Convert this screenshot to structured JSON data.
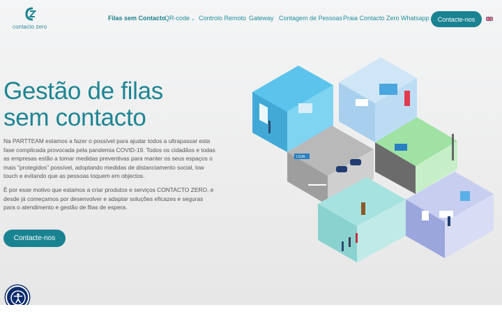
{
  "brand": {
    "logo_text": "contacto zero",
    "logo_mark": "CZ"
  },
  "nav": {
    "items": [
      {
        "label": "Filas sem Contacto",
        "active": true
      },
      {
        "label": "QR-code",
        "dropdown": true
      },
      {
        "label": "Controlo Remoto"
      },
      {
        "label": "Gateway"
      },
      {
        "label": "Contagem de Pessoas"
      },
      {
        "label": "Praia Contacto Zero"
      },
      {
        "label": "Whatsapp"
      }
    ],
    "cta_label": "Contacte-nos",
    "language_flag": "uk-flag-icon"
  },
  "hero": {
    "title_line1": "Gestão de filas",
    "title_line2": "sem contacto",
    "paragraph1": "Na PARTTEAM estamos a fazer o possível para ajudar todos a ultrapassar esta fase complicada provocada pela pandemia COVID-19. Todos os cidadãos e todas as empresas estão a tomar medidas preventivas para manter os seus espaços o mais \"protegidos\" possível, adoptando medidas de distanciamento social, low touch e evitando que as pessoas toquem em objectos.",
    "paragraph2": "É por esse motivo que estamos a criar produtos e serviços CONTACTO ZERO, e desde já começamos por desenvolver e adaptar soluções eficazes e seguras para o atendimento e gestão de filas de espera.",
    "cta_label": "Contacte-nos"
  },
  "illustration": {
    "sign_text": "LOJA"
  },
  "colors": {
    "brand": "#1a8391",
    "title": "#1e8593",
    "accessibility": "#0b2b6b"
  }
}
